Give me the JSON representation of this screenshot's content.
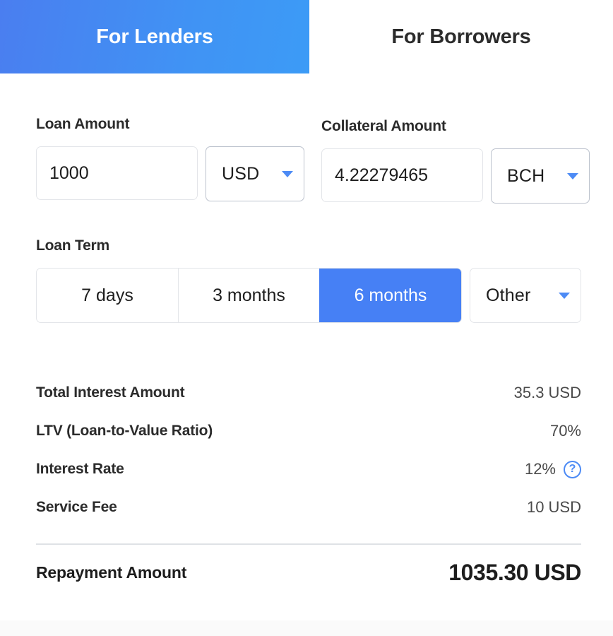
{
  "tabs": [
    {
      "label": "For Lenders",
      "active": true
    },
    {
      "label": "For Borrowers",
      "active": false
    }
  ],
  "loan_amount": {
    "label": "Loan Amount",
    "value": "1000",
    "placeholder": "Loan amount",
    "currency": "USD",
    "currency_caret": "chevron-down-icon"
  },
  "collateral_amount": {
    "label": "Collateral Amount",
    "value": "4.22279465",
    "placeholder": "Collateral amount",
    "currency": "BCH",
    "currency_caret": "chevron-down-icon"
  },
  "loan_term": {
    "label": "Loan Term",
    "options": [
      {
        "label": "7 days",
        "selected": false
      },
      {
        "label": "3 months",
        "selected": false
      },
      {
        "label": "6 months",
        "selected": true
      }
    ],
    "other": "Other"
  },
  "summary": {
    "rows": [
      {
        "label": "Total Interest Amount",
        "value": "35.3 USD",
        "help": false
      },
      {
        "label": "LTV (Loan-to-Value Ratio)",
        "value": "70%",
        "help": false
      },
      {
        "label": "Interest Rate",
        "value": "12%",
        "help": true,
        "help_glyph": "?"
      },
      {
        "label": "Service Fee",
        "value": "10 USD",
        "help": false
      }
    ],
    "total": {
      "label": "Repayment Amount",
      "value": "1035.30 USD"
    }
  },
  "colors": {
    "accent_blue": "#4680f5",
    "tab_gradient_start": "#4a7ef0",
    "tab_gradient_end": "#3c9bf6",
    "help_blue": "#4d8bf5",
    "border_light": "#e3e5e9",
    "border_select": "#bcc2cd",
    "divider": "#dfe2e6",
    "text_dark": "#2b2b2b",
    "text_value": "#4a4a4a"
  }
}
